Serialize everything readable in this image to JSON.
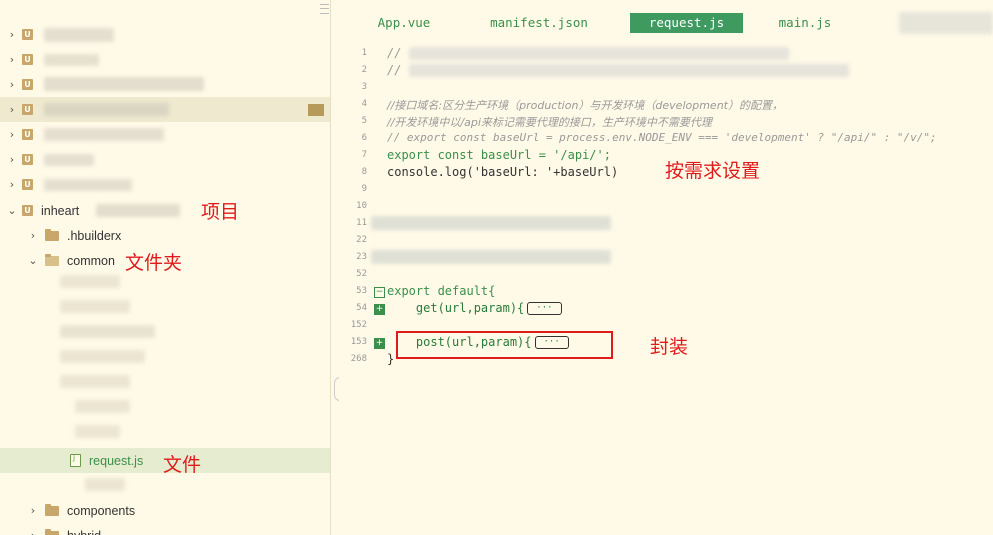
{
  "sidebar": {
    "projects": [
      {
        "name": "inheart",
        "expanded": true
      }
    ],
    "items": [
      {
        "label": ".hbuilderx",
        "type": "folder",
        "expanded": false
      },
      {
        "label": "common",
        "type": "folder",
        "expanded": true
      },
      {
        "label": "request.js",
        "type": "file",
        "selected": true
      },
      {
        "label": "components",
        "type": "folder",
        "expanded": false
      },
      {
        "label": "hybrid",
        "type": "folder",
        "expanded": false
      }
    ]
  },
  "annotations": {
    "project": "项目",
    "folder": "文件夹",
    "file": "文件",
    "configure": "按需求设置",
    "wrap": "封装"
  },
  "tabs": [
    {
      "label": "App.vue",
      "active": false
    },
    {
      "label": "manifest.json",
      "active": false
    },
    {
      "label": "request.js",
      "active": true
    },
    {
      "label": "main.js",
      "active": false
    }
  ],
  "editor": {
    "lines": [
      {
        "num": "1",
        "text": "//"
      },
      {
        "num": "2",
        "text": "//"
      },
      {
        "num": "3",
        "text": ""
      },
      {
        "num": "4",
        "text": "//接口域名:区分生产环境（production）与开发环境（development）的配置，"
      },
      {
        "num": "5",
        "text": "//开发环境中以/api来标记需要代理的接口，生产环境中不需要代理"
      },
      {
        "num": "6",
        "text": "// export const baseUrl = process.env.NODE_ENV === 'development' ? \"/api/\" : \"/v/\";"
      },
      {
        "num": "7",
        "text": "export const baseUrl = '/api/';"
      },
      {
        "num": "8",
        "text": "console.log('baseUrl: '+baseUrl)"
      },
      {
        "num": "9",
        "text": ""
      },
      {
        "num": "10",
        "text": ""
      },
      {
        "num": "11",
        "text": ""
      },
      {
        "num": "22",
        "text": ""
      },
      {
        "num": "23",
        "text": ""
      },
      {
        "num": "52",
        "text": ""
      },
      {
        "num": "53",
        "text": "export default{"
      },
      {
        "num": "54",
        "text": "    get(url,param){"
      },
      {
        "num": "152",
        "text": ""
      },
      {
        "num": "153",
        "text": "    post(url,param){"
      },
      {
        "num": "268",
        "text": "}"
      }
    ],
    "fold_placeholder": "···"
  },
  "colors": {
    "accent": "#3e9a5f",
    "annotation": "#e01b1b",
    "background": "#fffae8"
  }
}
